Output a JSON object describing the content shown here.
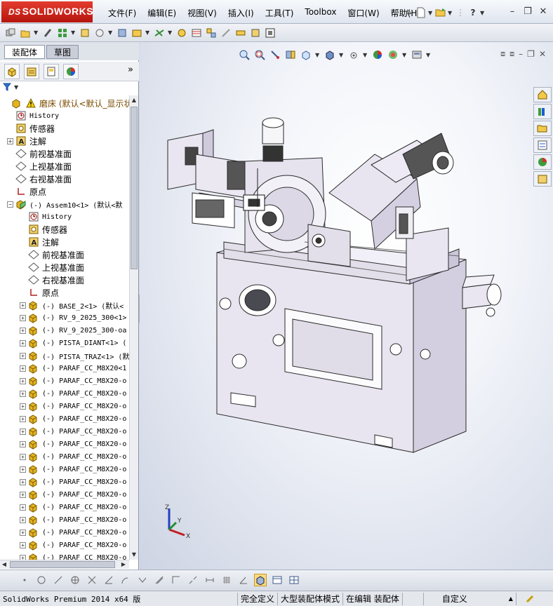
{
  "app": {
    "brand_prefix": "DS",
    "brand_name": "SOLIDWORKS"
  },
  "menu": [
    "文件(F)",
    "编辑(E)",
    "视图(V)",
    "插入(I)",
    "工具(T)",
    "Toolbox",
    "窗口(W)",
    "帮助(H)"
  ],
  "title_icons": [
    "pin-icon",
    "new-document-icon",
    "open-icon",
    "help-icon"
  ],
  "window_controls": [
    "minimize",
    "restore",
    "close"
  ],
  "toolbar2_icons": [
    "assembly-icon",
    "insert-component-icon",
    "mate-icon",
    "component-pattern-icon",
    "smart-fasteners-icon",
    "move-component-icon",
    "show-hidden-icon",
    "assembly-features-icon",
    "reference-geometry-icon",
    "new-motion-study-icon",
    "bill-of-materials-icon",
    "exploded-view-icon",
    "explode-line-icon",
    "interference-detection-icon",
    "clearance-verification-icon",
    "hole-alignment-icon",
    "measure-icon",
    "instant3d-icon"
  ],
  "panel": {
    "tabs": [
      "装配体",
      "草图"
    ],
    "active_tab": 0,
    "manager_icons": [
      "featuremanager-icon",
      "propertymanager-icon",
      "configurationmanager-icon",
      "appearance-icon"
    ],
    "more_label": "»",
    "filter_icon": "filter-icon"
  },
  "tree": [
    {
      "label": "磨床  (默认<默认_显示状",
      "level": 0,
      "icon": "assembly-warning-icon",
      "exp": "",
      "mono": false,
      "color": "#7a4b00"
    },
    {
      "label": "History",
      "level": 1,
      "icon": "history-icon",
      "exp": "",
      "mono": true
    },
    {
      "label": "传感器",
      "level": 1,
      "icon": "sensor-icon",
      "exp": "",
      "mono": false
    },
    {
      "label": "注解",
      "level": 1,
      "icon": "annotation-icon",
      "exp": "+",
      "mono": false
    },
    {
      "label": "前视基准面",
      "level": 1,
      "icon": "plane-icon",
      "exp": "",
      "mono": false
    },
    {
      "label": "上视基准面",
      "level": 1,
      "icon": "plane-icon",
      "exp": "",
      "mono": false
    },
    {
      "label": "右视基准面",
      "level": 1,
      "icon": "plane-icon",
      "exp": "",
      "mono": false
    },
    {
      "label": "原点",
      "level": 1,
      "icon": "origin-icon",
      "exp": "",
      "mono": false
    },
    {
      "label": "(-) Assem10<1> (默认<默",
      "level": 1,
      "icon": "subassembly-icon",
      "exp": "−",
      "mono": true
    },
    {
      "label": "History",
      "level": 2,
      "icon": "history-icon",
      "exp": "",
      "mono": true
    },
    {
      "label": "传感器",
      "level": 2,
      "icon": "sensor-icon",
      "exp": "",
      "mono": false
    },
    {
      "label": "注解",
      "level": 2,
      "icon": "annotation-icon",
      "exp": "",
      "mono": false
    },
    {
      "label": "前视基准面",
      "level": 2,
      "icon": "plane-icon",
      "exp": "",
      "mono": false
    },
    {
      "label": "上视基准面",
      "level": 2,
      "icon": "plane-icon",
      "exp": "",
      "mono": false
    },
    {
      "label": "右视基准面",
      "level": 2,
      "icon": "plane-icon",
      "exp": "",
      "mono": false
    },
    {
      "label": "原点",
      "level": 2,
      "icon": "origin-icon",
      "exp": "",
      "mono": false
    },
    {
      "label": "(-) BASE_2<1> (默认<",
      "level": 2,
      "icon": "part-icon",
      "exp": "+",
      "mono": true
    },
    {
      "label": "(-) RV_9_2025_300<1>",
      "level": 2,
      "icon": "part-icon",
      "exp": "+",
      "mono": true
    },
    {
      "label": "(-) RV_9_2025_300-oa",
      "level": 2,
      "icon": "part-icon",
      "exp": "+",
      "mono": true
    },
    {
      "label": "(-) PISTA_DIANT<1> (",
      "level": 2,
      "icon": "part-icon",
      "exp": "+",
      "mono": true
    },
    {
      "label": "(-) PISTA_TRAZ<1> (默",
      "level": 2,
      "icon": "part-icon",
      "exp": "+",
      "mono": true
    },
    {
      "label": "(-) PARAF_CC_M8X20<1",
      "level": 2,
      "icon": "part-icon",
      "exp": "+",
      "mono": true
    },
    {
      "label": "(-) PARAF_CC_M8X20-o",
      "level": 2,
      "icon": "part-icon",
      "exp": "+",
      "mono": true
    },
    {
      "label": "(-) PARAF_CC_M8X20-o",
      "level": 2,
      "icon": "part-icon",
      "exp": "+",
      "mono": true
    },
    {
      "label": "(-) PARAF_CC_M8X20-o",
      "level": 2,
      "icon": "part-icon",
      "exp": "+",
      "mono": true
    },
    {
      "label": "(-) PARAF_CC_M8X20-o",
      "level": 2,
      "icon": "part-icon",
      "exp": "+",
      "mono": true
    },
    {
      "label": "(-) PARAF_CC_M8X20-o",
      "level": 2,
      "icon": "part-icon",
      "exp": "+",
      "mono": true
    },
    {
      "label": "(-) PARAF_CC_M8X20-o",
      "level": 2,
      "icon": "part-icon",
      "exp": "+",
      "mono": true
    },
    {
      "label": "(-) PARAF_CC_M8X20-o",
      "level": 2,
      "icon": "part-icon",
      "exp": "+",
      "mono": true
    },
    {
      "label": "(-) PARAF_CC_M8X20-o",
      "level": 2,
      "icon": "part-icon",
      "exp": "+",
      "mono": true
    },
    {
      "label": "(-) PARAF_CC_M8X20-o",
      "level": 2,
      "icon": "part-icon",
      "exp": "+",
      "mono": true
    },
    {
      "label": "(-) PARAF_CC_M8X20-o",
      "level": 2,
      "icon": "part-icon",
      "exp": "+",
      "mono": true
    },
    {
      "label": "(-) PARAF_CC_M8X20-o",
      "level": 2,
      "icon": "part-icon",
      "exp": "+",
      "mono": true
    },
    {
      "label": "(-) PARAF_CC_M8X20-o",
      "level": 2,
      "icon": "part-icon",
      "exp": "+",
      "mono": true
    },
    {
      "label": "(-) PARAF_CC_M8X20-o",
      "level": 2,
      "icon": "part-icon",
      "exp": "+",
      "mono": true
    },
    {
      "label": "(-) PARAF_CC_M8X20-o",
      "level": 2,
      "icon": "part-icon",
      "exp": "+",
      "mono": true
    },
    {
      "label": "(-) PARAF_CC_M8X20-o",
      "level": 2,
      "icon": "part-icon",
      "exp": "+",
      "mono": true
    }
  ],
  "heads_up": [
    "zoom-to-fit-icon",
    "zoom-to-area-icon",
    "previous-view-icon",
    "section-view-icon",
    "view-orientation-icon",
    "display-style-icon",
    "hide-show-items-icon",
    "edit-appearance-icon",
    "apply-scene-icon",
    "view-settings-icon"
  ],
  "task_pane": [
    "home-icon",
    "design-library-icon",
    "file-explorer-icon",
    "view-palette-icon",
    "appearances-scenes-icon",
    "custom-properties-icon"
  ],
  "triad": {
    "x": "X",
    "y": "Y",
    "z": "Z"
  },
  "bottom_tools": [
    "point-icon",
    "circle-icon",
    "line-icon",
    "polygon-icon",
    "trim-icon",
    "extend-icon",
    "offset-icon",
    "convert-icon",
    "mirror-icon",
    "corner-icon",
    "centerline-icon",
    "smart-dimension-icon",
    "grid-icon",
    "angle-icon",
    "3d-view-icon",
    "single-view-icon",
    "two-view-icon"
  ],
  "status": {
    "app": "SolidWorks Premium 2014 x64 版",
    "definition": "完全定义",
    "mode": "大型装配体模式",
    "editing": "在编辑 装配体",
    "units": "自定义",
    "units_arrow": "▲"
  },
  "colors": {
    "brand": "#c8261b",
    "machine_body": "#e4e1ec",
    "machine_edge": "#2a2a2a",
    "part_icon": "#e5b322"
  }
}
